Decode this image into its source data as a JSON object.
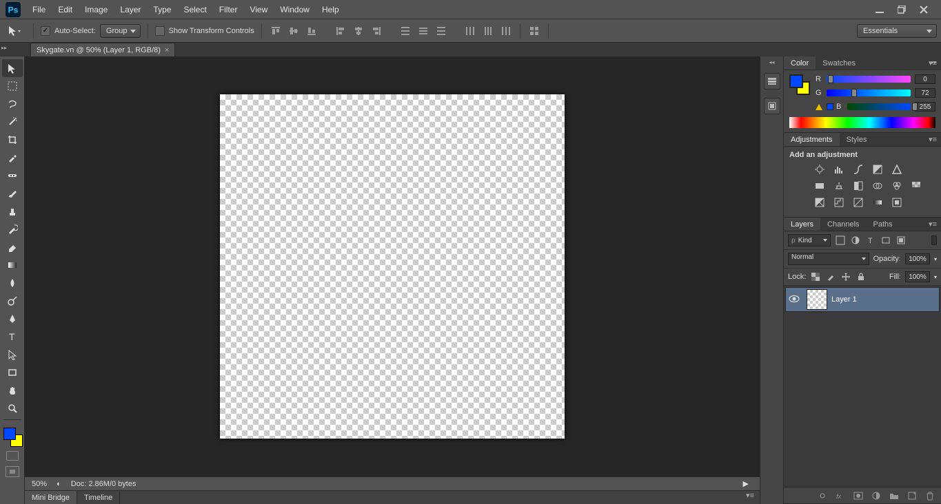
{
  "menu": [
    "File",
    "Edit",
    "Image",
    "Layer",
    "Type",
    "Select",
    "Filter",
    "View",
    "Window",
    "Help"
  ],
  "options": {
    "auto_select_label": "Auto-Select:",
    "group_label": "Group",
    "show_transform_label": "Show Transform Controls"
  },
  "workspace_label": "Essentials",
  "document_tab": "Skygate.vn @ 50% (Layer 1, RGB/8)",
  "status": {
    "zoom": "50%",
    "doc": "Doc: 2.86M/0 bytes"
  },
  "mini_tabs": [
    "Mini Bridge",
    "Timeline"
  ],
  "color_panel": {
    "tabs": [
      "Color",
      "Swatches"
    ],
    "r": {
      "label": "R",
      "value": "0",
      "pos": 0
    },
    "g": {
      "label": "G",
      "value": "72",
      "pos": 28
    },
    "b": {
      "label": "B",
      "value": "255",
      "pos": 100
    }
  },
  "adjustments_panel": {
    "tabs": [
      "Adjustments",
      "Styles"
    ],
    "title": "Add an adjustment"
  },
  "layers_panel": {
    "tabs": [
      "Layers",
      "Channels",
      "Paths"
    ],
    "kind": "Kind",
    "blend": "Normal",
    "opacity_label": "Opacity:",
    "opacity_value": "100%",
    "lock_label": "Lock:",
    "fill_label": "Fill:",
    "fill_value": "100%",
    "layer_name": "Layer 1"
  }
}
